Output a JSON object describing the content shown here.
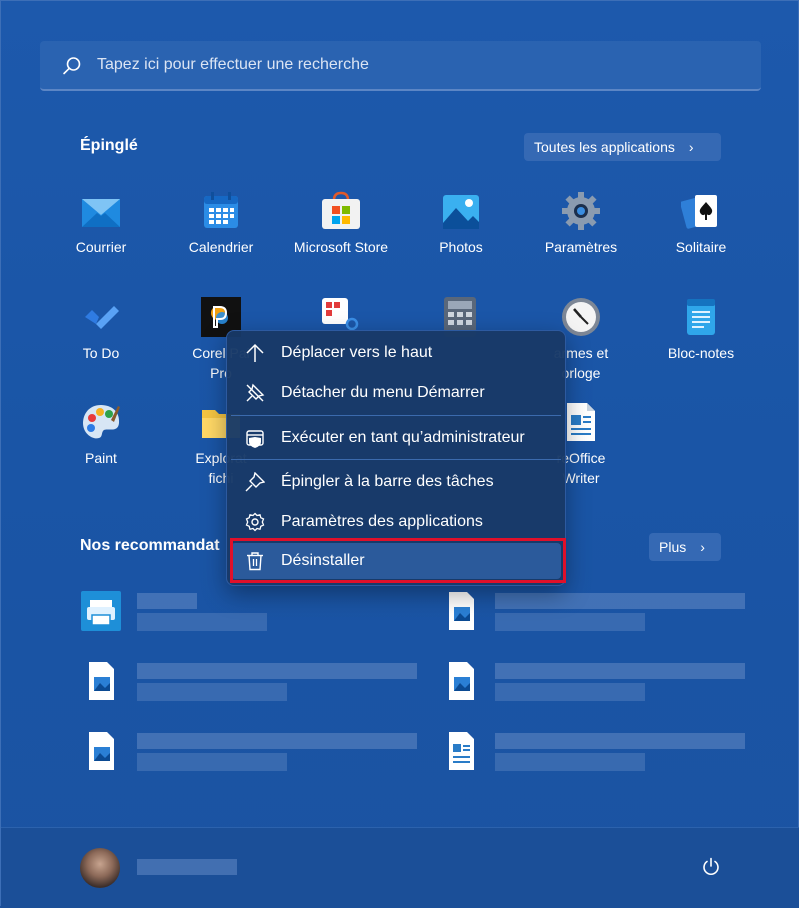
{
  "search": {
    "placeholder": "Tapez ici pour effectuer une recherche"
  },
  "pinned": {
    "title": "Épinglé",
    "all_apps_label": "Toutes les applications",
    "apps": [
      {
        "label": "Courrier",
        "icon": "mail-icon"
      },
      {
        "label": "Calendrier",
        "icon": "calendar-icon"
      },
      {
        "label": "Microsoft Store",
        "icon": "store-icon"
      },
      {
        "label": "Photos",
        "icon": "photos-icon"
      },
      {
        "label": "Paramètres",
        "icon": "settings-gear-icon"
      },
      {
        "label": "Solitaire",
        "icon": "solitaire-cards-icon"
      },
      {
        "label": "To Do",
        "icon": "todo-check-icon"
      },
      {
        "label": "Corel Pai",
        "label2": "Pro",
        "icon": "corel-painter-icon"
      },
      {
        "label": "",
        "icon": "snipping-tool-icon"
      },
      {
        "label": "",
        "icon": "calculator-icon"
      },
      {
        "label": "armes et",
        "label2": "orloge",
        "icon": "clock-icon"
      },
      {
        "label": "Bloc-notes",
        "icon": "notepad-icon"
      },
      {
        "label": "Paint",
        "icon": "paint-palette-icon"
      },
      {
        "label": "Explorat",
        "label2": "fichi",
        "icon": "file-explorer-folder-icon"
      },
      {
        "label": "reOffice",
        "label2": "Writer",
        "icon": "libreoffice-writer-icon"
      }
    ]
  },
  "context_menu": {
    "items": [
      {
        "label": "Déplacer vers le haut",
        "icon": "arrow-up-icon"
      },
      {
        "label": "Détacher du menu Démarrer",
        "icon": "unpin-icon"
      },
      {
        "label": "Exécuter en tant qu’administrateur",
        "icon": "admin-shield-icon"
      },
      {
        "label": "Épingler à la barre des tâches",
        "icon": "pin-icon"
      },
      {
        "label": "Paramètres des applications",
        "icon": "gear-icon"
      },
      {
        "label": "Désinstaller",
        "icon": "trash-icon"
      }
    ]
  },
  "recommended": {
    "title": "Nos recommandat",
    "more_label": "Plus"
  },
  "colors": {
    "background": "#1b53a2",
    "menu": "#183967",
    "highlight_border": "#e0102a"
  }
}
